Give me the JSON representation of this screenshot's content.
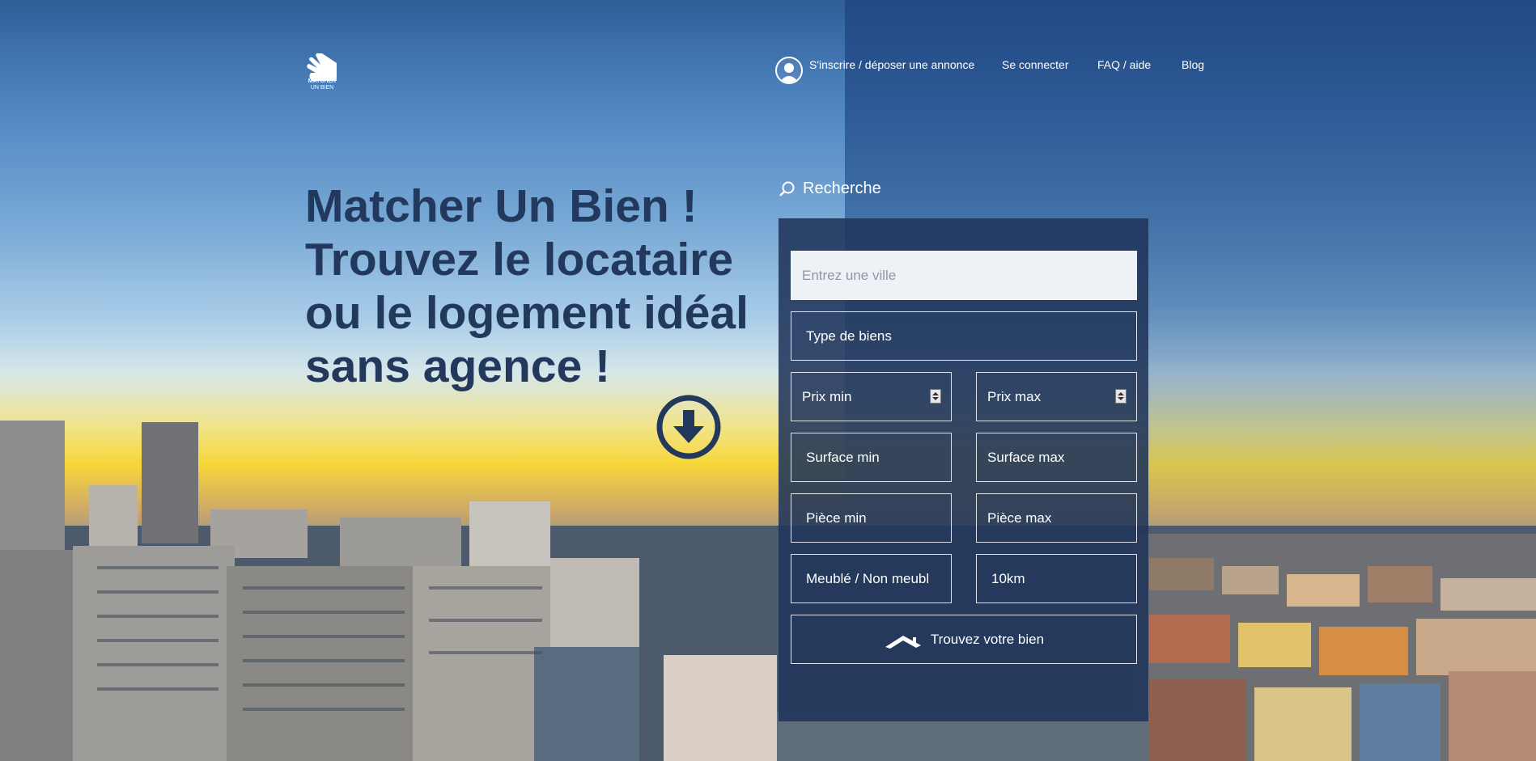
{
  "brand": {
    "logo_line1": "MATCHER",
    "logo_line2": "UN BIEN",
    "logo_icon": "house-hand-logo"
  },
  "nav": {
    "register": "S'inscrire / déposer une annonce",
    "login": "Se connecter",
    "faq": "FAQ / aide",
    "blog": "Blog"
  },
  "hero": {
    "line1": "Matcher Un Bien !",
    "line2": "Trouvez le locataire",
    "line3": "ou le logement idéal",
    "line4": "sans agence !"
  },
  "search": {
    "heading": "Recherche",
    "city_placeholder": "Entrez une ville",
    "type": "Type de biens",
    "price_min": "Prix min",
    "price_max": "Prix max",
    "surface_min": "Surface min",
    "surface_max": "Surface max",
    "rooms_min": "Pièce min",
    "rooms_max": "Pièce max",
    "furnished": "Meublé / Non meubl",
    "radius": "10km",
    "submit": "Trouvez votre bien"
  },
  "colors": {
    "panel": "#20345a",
    "hero_text": "#22385c"
  }
}
